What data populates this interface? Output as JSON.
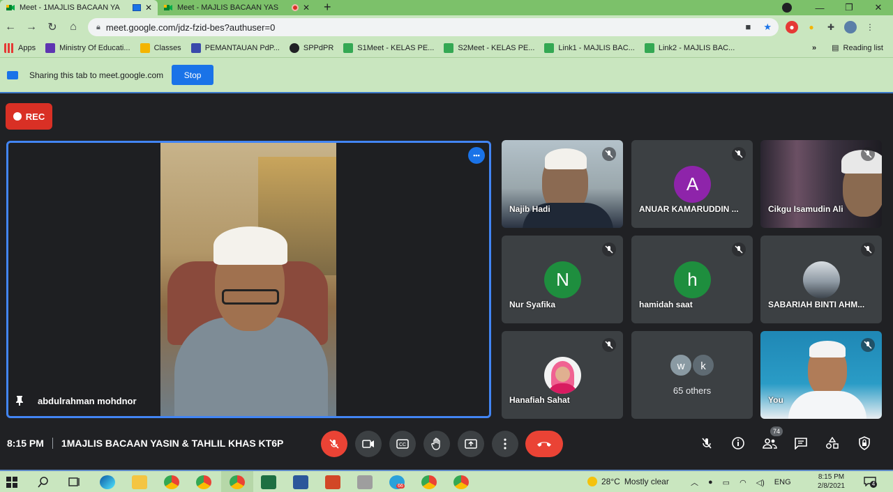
{
  "browser": {
    "tabs": [
      {
        "label": "Meet - 1MAJLIS BACAAN YA",
        "active": true
      },
      {
        "label": "Meet - MAJLIS BACAAN YAS",
        "active": false
      }
    ],
    "url": "meet.google.com/jdz-fzid-bes?authuser=0",
    "bookmarks": [
      {
        "label": "Apps",
        "color": "#e53935"
      },
      {
        "label": "Ministry Of Educati...",
        "color": "#5e35b1"
      },
      {
        "label": "Classes",
        "color": "#f4b400"
      },
      {
        "label": "PEMANTAUAN PdP...",
        "color": "#3949ab"
      },
      {
        "label": "SPPdPR",
        "color": "#202124"
      },
      {
        "label": "S1Meet - KELAS PE...",
        "color": "#34a853"
      },
      {
        "label": "S2Meet - KELAS PE...",
        "color": "#34a853"
      },
      {
        "label": "Link1 - MAJLIS BAC...",
        "color": "#34a853"
      },
      {
        "label": "Link2 - MAJLIS BAC...",
        "color": "#34a853"
      }
    ],
    "reading_list": "Reading list",
    "more_bookmarks": "»"
  },
  "share_bar": {
    "text": "Sharing this tab to meet.google.com",
    "stop_label": "Stop"
  },
  "meet": {
    "rec_label": "REC",
    "main_tile": {
      "name": "abdulrahman mohdnor"
    },
    "participants": [
      {
        "name": "Najib Hadi",
        "type": "video"
      },
      {
        "name": "ANUAR KAMARUDDIN ...",
        "type": "letter",
        "letter": "A",
        "color": "#8e24aa"
      },
      {
        "name": "Cikgu Isamudin Ali",
        "type": "video"
      },
      {
        "name": "Nur Syafika",
        "type": "letter",
        "letter": "N",
        "color": "#1e8e3e"
      },
      {
        "name": "hamidah saat",
        "type": "letter",
        "letter": "h",
        "color": "#1e8e3e"
      },
      {
        "name": "SABARIAH BINTI AHM...",
        "type": "photo"
      },
      {
        "name": "Hanafiah Sahat",
        "type": "photo"
      },
      {
        "name": "65 others",
        "type": "others",
        "letters": [
          "w",
          "k"
        ]
      },
      {
        "name": "You",
        "type": "video"
      }
    ],
    "time": "8:15 PM",
    "meeting_title": "1MAJLIS BACAAN YASIN & TAHLIL KHAS KT6P",
    "people_count": "74",
    "more_dots": "•••"
  },
  "taskbar": {
    "temperature": "28°C",
    "weather": "Mostly clear",
    "language": "ENG",
    "time": "8:15 PM",
    "date": "2/8/2021",
    "telegram_badge": "66",
    "notifications": "4"
  },
  "colors": {
    "accent": "#1a73e8",
    "danger": "#ea4335",
    "meet_bg": "#202124",
    "tile_bg": "#3c4043",
    "chrome_green": "#c9e6bf"
  }
}
